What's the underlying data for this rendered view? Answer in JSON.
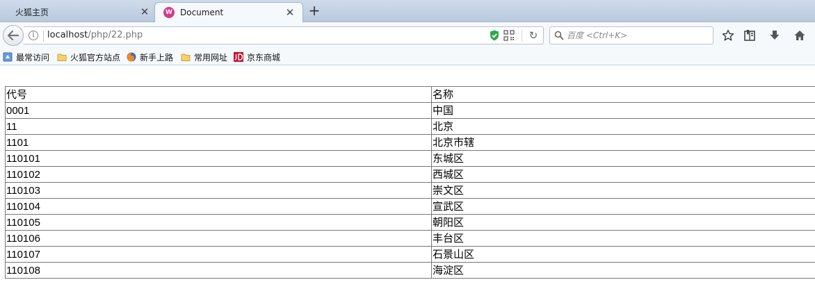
{
  "browser": {
    "tabs": [
      {
        "title": "火狐主页",
        "active": false
      },
      {
        "title": "Document",
        "active": true
      }
    ],
    "new_tab_label": "+",
    "url": {
      "host": "localhost",
      "path": "/php/22.php"
    },
    "search": {
      "placeholder": "百度 <Ctrl+K>"
    },
    "bookmarks": [
      {
        "label": "最常访问",
        "icon": "bookmark-folder-blue-icon"
      },
      {
        "label": "火狐官方站点",
        "icon": "folder-icon"
      },
      {
        "label": "新手上路",
        "icon": "firefox-icon"
      },
      {
        "label": "常用网址",
        "icon": "folder-icon"
      },
      {
        "label": "京东商城",
        "icon": "jd-logo-icon"
      }
    ]
  },
  "table": {
    "headers": [
      "代号",
      "名称"
    ],
    "rows": [
      [
        "0001",
        "中国"
      ],
      [
        "11",
        "北京"
      ],
      [
        "1101",
        "北京市辖"
      ],
      [
        "110101",
        "东城区"
      ],
      [
        "110102",
        "西城区"
      ],
      [
        "110103",
        "崇文区"
      ],
      [
        "110104",
        "宣武区"
      ],
      [
        "110105",
        "朝阳区"
      ],
      [
        "110106",
        "丰台区"
      ],
      [
        "110107",
        "石景山区"
      ],
      [
        "110108",
        "海淀区"
      ]
    ]
  },
  "colors": {
    "tabstrip": "#c5d4e6",
    "active_tab": "#f6f9fc",
    "shield_green": "#2fa84f",
    "jd_red": "#c8102e",
    "favicon_pink": "#d63a8a"
  }
}
